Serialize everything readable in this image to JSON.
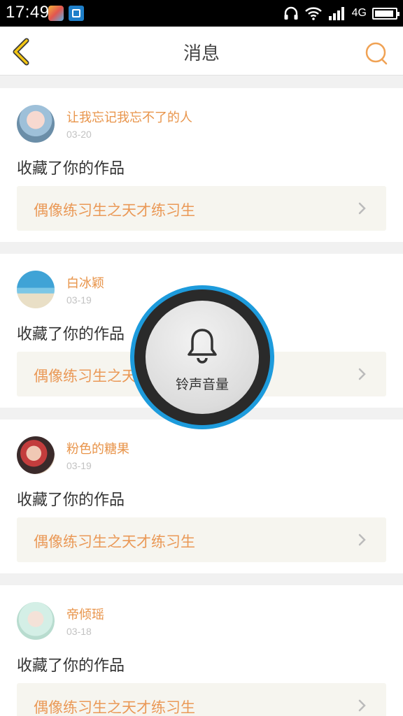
{
  "status_bar": {
    "time": "17:49",
    "network": "4G"
  },
  "header": {
    "title": "消息",
    "back_icon": "chevron-left-icon",
    "search_icon": "search-icon"
  },
  "colors": {
    "accent": "#e8944a",
    "work_bg": "#f6f5ef",
    "overlay_ring": "#1d9bdc"
  },
  "messages": [
    {
      "user": "让我忘记我忘不了的人",
      "date": "03-20",
      "action": "收藏了你的作品",
      "work": "偶像练习生之天才练习生"
    },
    {
      "user": "白冰颖",
      "date": "03-19",
      "action": "收藏了你的作品",
      "work": "偶像练习生之天才练习生"
    },
    {
      "user": "粉色的糖果",
      "date": "03-19",
      "action": "收藏了你的作品",
      "work": "偶像练习生之天才练习生"
    },
    {
      "user": "帝倾瑶",
      "date": "03-18",
      "action": "收藏了你的作品",
      "work": "偶像练习生之天才练习生"
    }
  ],
  "volume_overlay": {
    "label": "铃声音量",
    "icon": "bell-icon"
  }
}
